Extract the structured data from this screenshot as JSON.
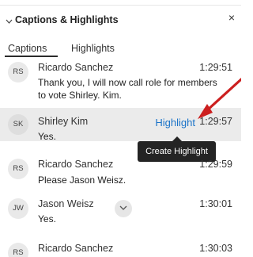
{
  "panel": {
    "title": "Captions & Highlights",
    "close_glyph": "×",
    "tabs": [
      {
        "label": "Captions",
        "active": true
      },
      {
        "label": "Highlights",
        "active": false
      }
    ]
  },
  "captions": [
    {
      "initials": "RS",
      "name": "Ricardo Sanchez",
      "time": "1:29:51",
      "text": "Thank you, I will now call role for members to vote Shirley. Kim."
    },
    {
      "initials": "SK",
      "name": "Shirley Kim",
      "time": "1:29:57",
      "text": "Yes.",
      "selected": true,
      "highlight_label": "Highlight",
      "tooltip": "Create Highlight"
    },
    {
      "initials": "RS",
      "name": "Ricardo Sanchez",
      "time": "1:29:59",
      "text": "Please Jason Weisz."
    },
    {
      "initials": "JW",
      "name": "Jason Weisz",
      "time": "1:30:01",
      "text": "Yes."
    },
    {
      "initials": "RS",
      "name": "Ricardo Sanchez",
      "time": "1:30:03",
      "text": ""
    }
  ],
  "colors": {
    "accent_blue": "#1a73c8",
    "annotation_red": "#cc1f1f",
    "selected_row_bg": "#ebebeb",
    "tooltip_bg": "#242424"
  },
  "icons": {
    "collapse": "chevron-down-icon",
    "close": "close-icon",
    "scroll_down": "chevron-down-icon"
  }
}
